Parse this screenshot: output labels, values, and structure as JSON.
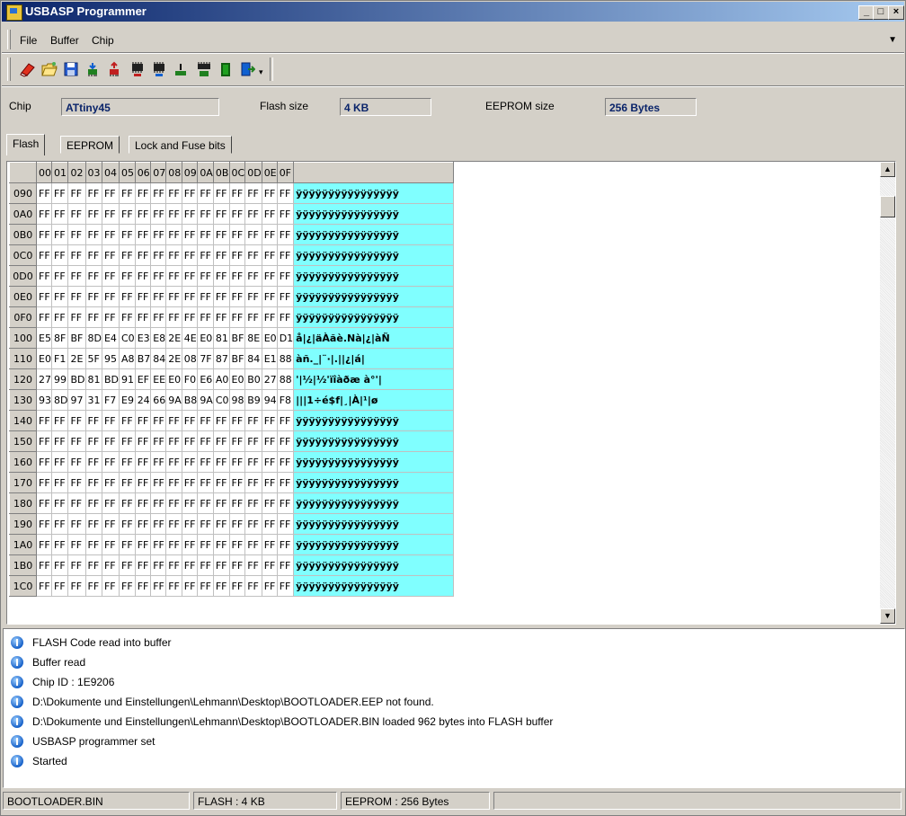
{
  "window": {
    "title": "USBASP Programmer"
  },
  "menu": {
    "items": [
      "File",
      "Buffer",
      "Chip"
    ]
  },
  "toolbar": {
    "icons": [
      "eraser-icon",
      "open-folder-icon",
      "save-disk-icon",
      "read-chip-icon",
      "write-chip-icon",
      "read-flash-icon",
      "write-flash-icon",
      "verify-chip-icon",
      "read-eeprom-icon",
      "program-icon",
      "exit-icon"
    ]
  },
  "chip": {
    "chip_label": "Chip",
    "chip_value": "ATtiny45",
    "flash_label": "Flash size",
    "flash_value": "4 KB",
    "eeprom_label": "EEPROM size",
    "eeprom_value": "256 Bytes"
  },
  "tabs": [
    "Flash",
    "EEPROM",
    "Lock and Fuse bits"
  ],
  "hex": {
    "columns": [
      "00",
      "01",
      "02",
      "03",
      "04",
      "05",
      "06",
      "07",
      "08",
      "09",
      "0A",
      "0B",
      "0C",
      "0D",
      "0E",
      "0F"
    ],
    "rows": [
      {
        "addr": "090",
        "bytes": [
          "FF",
          "FF",
          "FF",
          "FF",
          "FF",
          "FF",
          "FF",
          "FF",
          "FF",
          "FF",
          "FF",
          "FF",
          "FF",
          "FF",
          "FF",
          "FF"
        ],
        "ascii": "ÿÿÿÿÿÿÿÿÿÿÿÿÿÿÿÿ"
      },
      {
        "addr": "0A0",
        "bytes": [
          "FF",
          "FF",
          "FF",
          "FF",
          "FF",
          "FF",
          "FF",
          "FF",
          "FF",
          "FF",
          "FF",
          "FF",
          "FF",
          "FF",
          "FF",
          "FF"
        ],
        "ascii": "ÿÿÿÿÿÿÿÿÿÿÿÿÿÿÿÿ"
      },
      {
        "addr": "0B0",
        "bytes": [
          "FF",
          "FF",
          "FF",
          "FF",
          "FF",
          "FF",
          "FF",
          "FF",
          "FF",
          "FF",
          "FF",
          "FF",
          "FF",
          "FF",
          "FF",
          "FF"
        ],
        "ascii": "ÿÿÿÿÿÿÿÿÿÿÿÿÿÿÿÿ"
      },
      {
        "addr": "0C0",
        "bytes": [
          "FF",
          "FF",
          "FF",
          "FF",
          "FF",
          "FF",
          "FF",
          "FF",
          "FF",
          "FF",
          "FF",
          "FF",
          "FF",
          "FF",
          "FF",
          "FF"
        ],
        "ascii": "ÿÿÿÿÿÿÿÿÿÿÿÿÿÿÿÿ"
      },
      {
        "addr": "0D0",
        "bytes": [
          "FF",
          "FF",
          "FF",
          "FF",
          "FF",
          "FF",
          "FF",
          "FF",
          "FF",
          "FF",
          "FF",
          "FF",
          "FF",
          "FF",
          "FF",
          "FF"
        ],
        "ascii": "ÿÿÿÿÿÿÿÿÿÿÿÿÿÿÿÿ"
      },
      {
        "addr": "0E0",
        "bytes": [
          "FF",
          "FF",
          "FF",
          "FF",
          "FF",
          "FF",
          "FF",
          "FF",
          "FF",
          "FF",
          "FF",
          "FF",
          "FF",
          "FF",
          "FF",
          "FF"
        ],
        "ascii": "ÿÿÿÿÿÿÿÿÿÿÿÿÿÿÿÿ"
      },
      {
        "addr": "0F0",
        "bytes": [
          "FF",
          "FF",
          "FF",
          "FF",
          "FF",
          "FF",
          "FF",
          "FF",
          "FF",
          "FF",
          "FF",
          "FF",
          "FF",
          "FF",
          "FF",
          "FF"
        ],
        "ascii": "ÿÿÿÿÿÿÿÿÿÿÿÿÿÿÿÿ"
      },
      {
        "addr": "100",
        "bytes": [
          "E5",
          "8F",
          "BF",
          "8D",
          "E4",
          "C0",
          "E3",
          "E8",
          "2E",
          "4E",
          "E0",
          "81",
          "BF",
          "8E",
          "E0",
          "D1"
        ],
        "ascii": "å|¿|äÀãè.Nà|¿|àÑ"
      },
      {
        "addr": "110",
        "bytes": [
          "E0",
          "F1",
          "2E",
          "5F",
          "95",
          "A8",
          "B7",
          "84",
          "2E",
          "08",
          "7F",
          "87",
          "BF",
          "84",
          "E1",
          "88"
        ],
        "ascii": "àñ._|¨·|.||¿|á|"
      },
      {
        "addr": "120",
        "bytes": [
          "27",
          "99",
          "BD",
          "81",
          "BD",
          "91",
          "EF",
          "EE",
          "E0",
          "F0",
          "E6",
          "A0",
          "E0",
          "B0",
          "27",
          "88"
        ],
        "ascii": "'|½|½'ïîàðæ à°'|"
      },
      {
        "addr": "130",
        "bytes": [
          "93",
          "8D",
          "97",
          "31",
          "F7",
          "E9",
          "24",
          "66",
          "9A",
          "B8",
          "9A",
          "C0",
          "98",
          "B9",
          "94",
          "F8"
        ],
        "ascii": "|||1÷é$f|¸|À|¹|ø"
      },
      {
        "addr": "140",
        "bytes": [
          "FF",
          "FF",
          "FF",
          "FF",
          "FF",
          "FF",
          "FF",
          "FF",
          "FF",
          "FF",
          "FF",
          "FF",
          "FF",
          "FF",
          "FF",
          "FF"
        ],
        "ascii": "ÿÿÿÿÿÿÿÿÿÿÿÿÿÿÿÿ"
      },
      {
        "addr": "150",
        "bytes": [
          "FF",
          "FF",
          "FF",
          "FF",
          "FF",
          "FF",
          "FF",
          "FF",
          "FF",
          "FF",
          "FF",
          "FF",
          "FF",
          "FF",
          "FF",
          "FF"
        ],
        "ascii": "ÿÿÿÿÿÿÿÿÿÿÿÿÿÿÿÿ"
      },
      {
        "addr": "160",
        "bytes": [
          "FF",
          "FF",
          "FF",
          "FF",
          "FF",
          "FF",
          "FF",
          "FF",
          "FF",
          "FF",
          "FF",
          "FF",
          "FF",
          "FF",
          "FF",
          "FF"
        ],
        "ascii": "ÿÿÿÿÿÿÿÿÿÿÿÿÿÿÿÿ"
      },
      {
        "addr": "170",
        "bytes": [
          "FF",
          "FF",
          "FF",
          "FF",
          "FF",
          "FF",
          "FF",
          "FF",
          "FF",
          "FF",
          "FF",
          "FF",
          "FF",
          "FF",
          "FF",
          "FF"
        ],
        "ascii": "ÿÿÿÿÿÿÿÿÿÿÿÿÿÿÿÿ"
      },
      {
        "addr": "180",
        "bytes": [
          "FF",
          "FF",
          "FF",
          "FF",
          "FF",
          "FF",
          "FF",
          "FF",
          "FF",
          "FF",
          "FF",
          "FF",
          "FF",
          "FF",
          "FF",
          "FF"
        ],
        "ascii": "ÿÿÿÿÿÿÿÿÿÿÿÿÿÿÿÿ"
      },
      {
        "addr": "190",
        "bytes": [
          "FF",
          "FF",
          "FF",
          "FF",
          "FF",
          "FF",
          "FF",
          "FF",
          "FF",
          "FF",
          "FF",
          "FF",
          "FF",
          "FF",
          "FF",
          "FF"
        ],
        "ascii": "ÿÿÿÿÿÿÿÿÿÿÿÿÿÿÿÿ"
      },
      {
        "addr": "1A0",
        "bytes": [
          "FF",
          "FF",
          "FF",
          "FF",
          "FF",
          "FF",
          "FF",
          "FF",
          "FF",
          "FF",
          "FF",
          "FF",
          "FF",
          "FF",
          "FF",
          "FF"
        ],
        "ascii": "ÿÿÿÿÿÿÿÿÿÿÿÿÿÿÿÿ"
      },
      {
        "addr": "1B0",
        "bytes": [
          "FF",
          "FF",
          "FF",
          "FF",
          "FF",
          "FF",
          "FF",
          "FF",
          "FF",
          "FF",
          "FF",
          "FF",
          "FF",
          "FF",
          "FF",
          "FF"
        ],
        "ascii": "ÿÿÿÿÿÿÿÿÿÿÿÿÿÿÿÿ"
      },
      {
        "addr": "1C0",
        "bytes": [
          "FF",
          "FF",
          "FF",
          "FF",
          "FF",
          "FF",
          "FF",
          "FF",
          "FF",
          "FF",
          "FF",
          "FF",
          "FF",
          "FF",
          "FF",
          "FF"
        ],
        "ascii": "ÿÿÿÿÿÿÿÿÿÿÿÿÿÿÿÿ"
      }
    ]
  },
  "log": [
    "FLASH Code read into buffer",
    "Buffer read",
    "Chip ID : 1E9206",
    "D:\\Dokumente und Einstellungen\\Lehmann\\Desktop\\BOOTLOADER.EEP not found.",
    "D:\\Dokumente und Einstellungen\\Lehmann\\Desktop\\BOOTLOADER.BIN loaded 962 bytes into FLASH buffer",
    "USBASP programmer set",
    "Started"
  ],
  "status": {
    "file": "BOOTLOADER.BIN",
    "flash": "FLASH : 4 KB",
    "eeprom": "EEPROM : 256 Bytes"
  },
  "colors": {
    "ascii_bg": "#80ffff",
    "title_start": "#0a246a",
    "title_end": "#a6caf0",
    "value_text": "#0a246a"
  }
}
